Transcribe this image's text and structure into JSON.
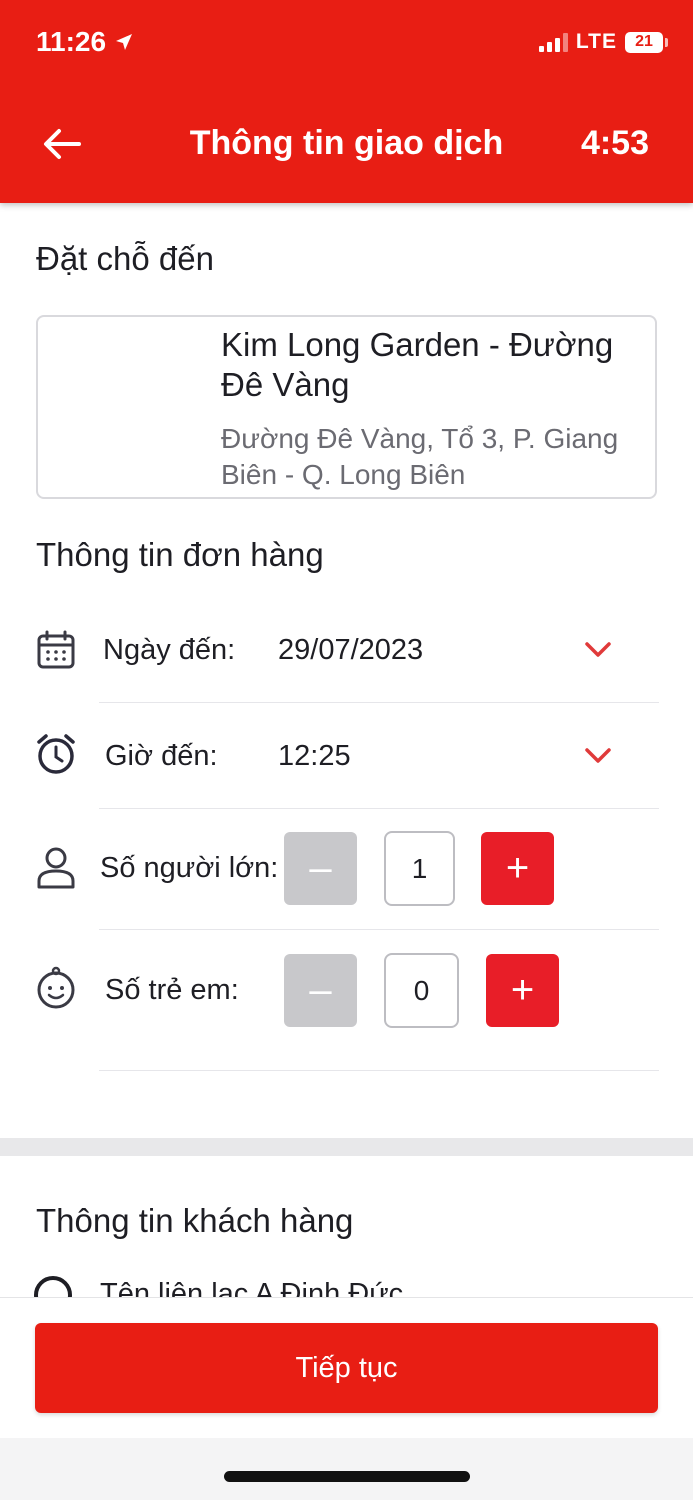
{
  "status_bar": {
    "time": "11:26",
    "network": "LTE",
    "battery": "21"
  },
  "header": {
    "title": "Thông tin giao dịch",
    "countdown": "4:53"
  },
  "destination": {
    "section_title": "Đặt chỗ đến",
    "name": "Kim Long Garden - Đường Đê Vàng",
    "address": "Đường Đê Vàng, Tổ 3, P. Giang Biên - Q. Long Biên"
  },
  "order": {
    "section_title": "Thông tin đơn hàng",
    "date_label": "Ngày đến:",
    "date_value": "29/07/2023",
    "time_label": "Giờ đến:",
    "time_value": "12:25",
    "adults_label": "Số người lớn:",
    "adults_value": "1",
    "children_label": "Số trẻ em:",
    "children_value": "0",
    "minus_symbol": "–",
    "plus_symbol": "+"
  },
  "customer": {
    "section_title": "Thông tin khách hàng",
    "contact_partial": "Tên liên lạc   A Đinh Đức"
  },
  "footer": {
    "continue_label": "Tiếp tục"
  },
  "colors": {
    "brand_red": "#e81e14",
    "stepper_disabled": "#c8c8cb"
  }
}
